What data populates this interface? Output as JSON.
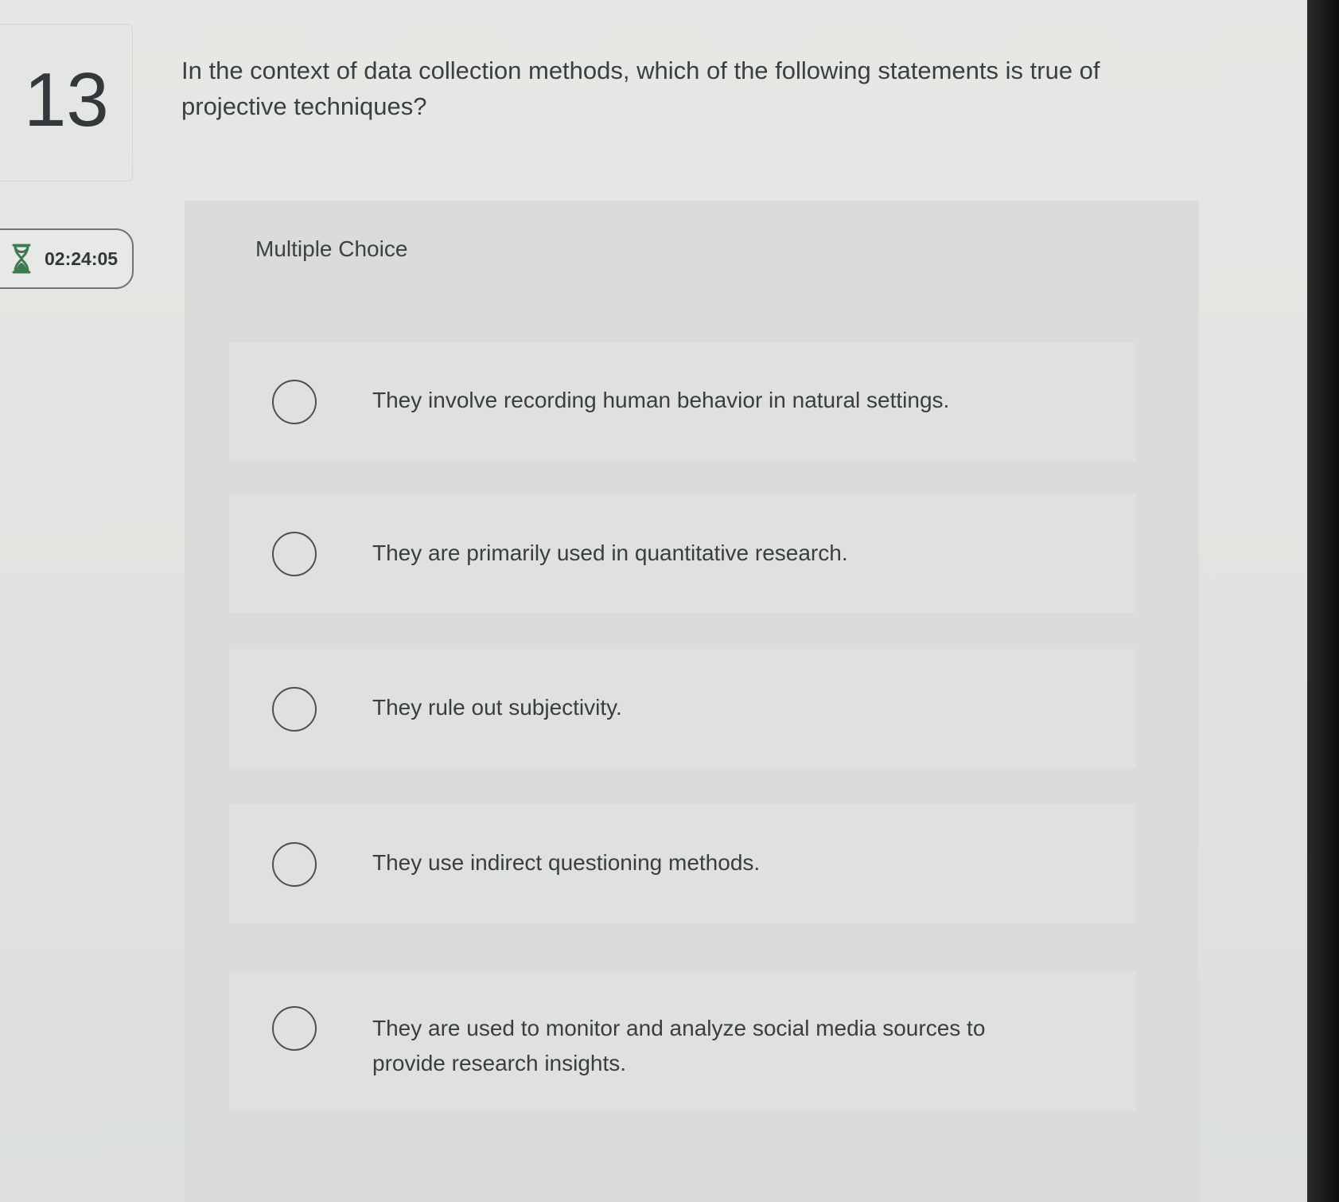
{
  "question": {
    "number": "13",
    "text": "In the context of data collection methods, which of the following statements is true of projective techniques?"
  },
  "timer": {
    "icon": "hourglass-icon",
    "time": "02:24:05"
  },
  "choices": {
    "label": "Multiple Choice",
    "options": [
      {
        "label": "They involve recording human behavior in natural settings."
      },
      {
        "label": "They are primarily used in quantitative research."
      },
      {
        "label": "They rule out subjectivity."
      },
      {
        "label": "They use indirect questioning methods."
      },
      {
        "label": "They are used to monitor and analyze social media sources to provide research insights."
      }
    ]
  },
  "colors": {
    "background": "#e2e4e1",
    "panel": "#dadcd9",
    "text": "#3a3d42",
    "timer_icon": "#3e7a4f"
  }
}
